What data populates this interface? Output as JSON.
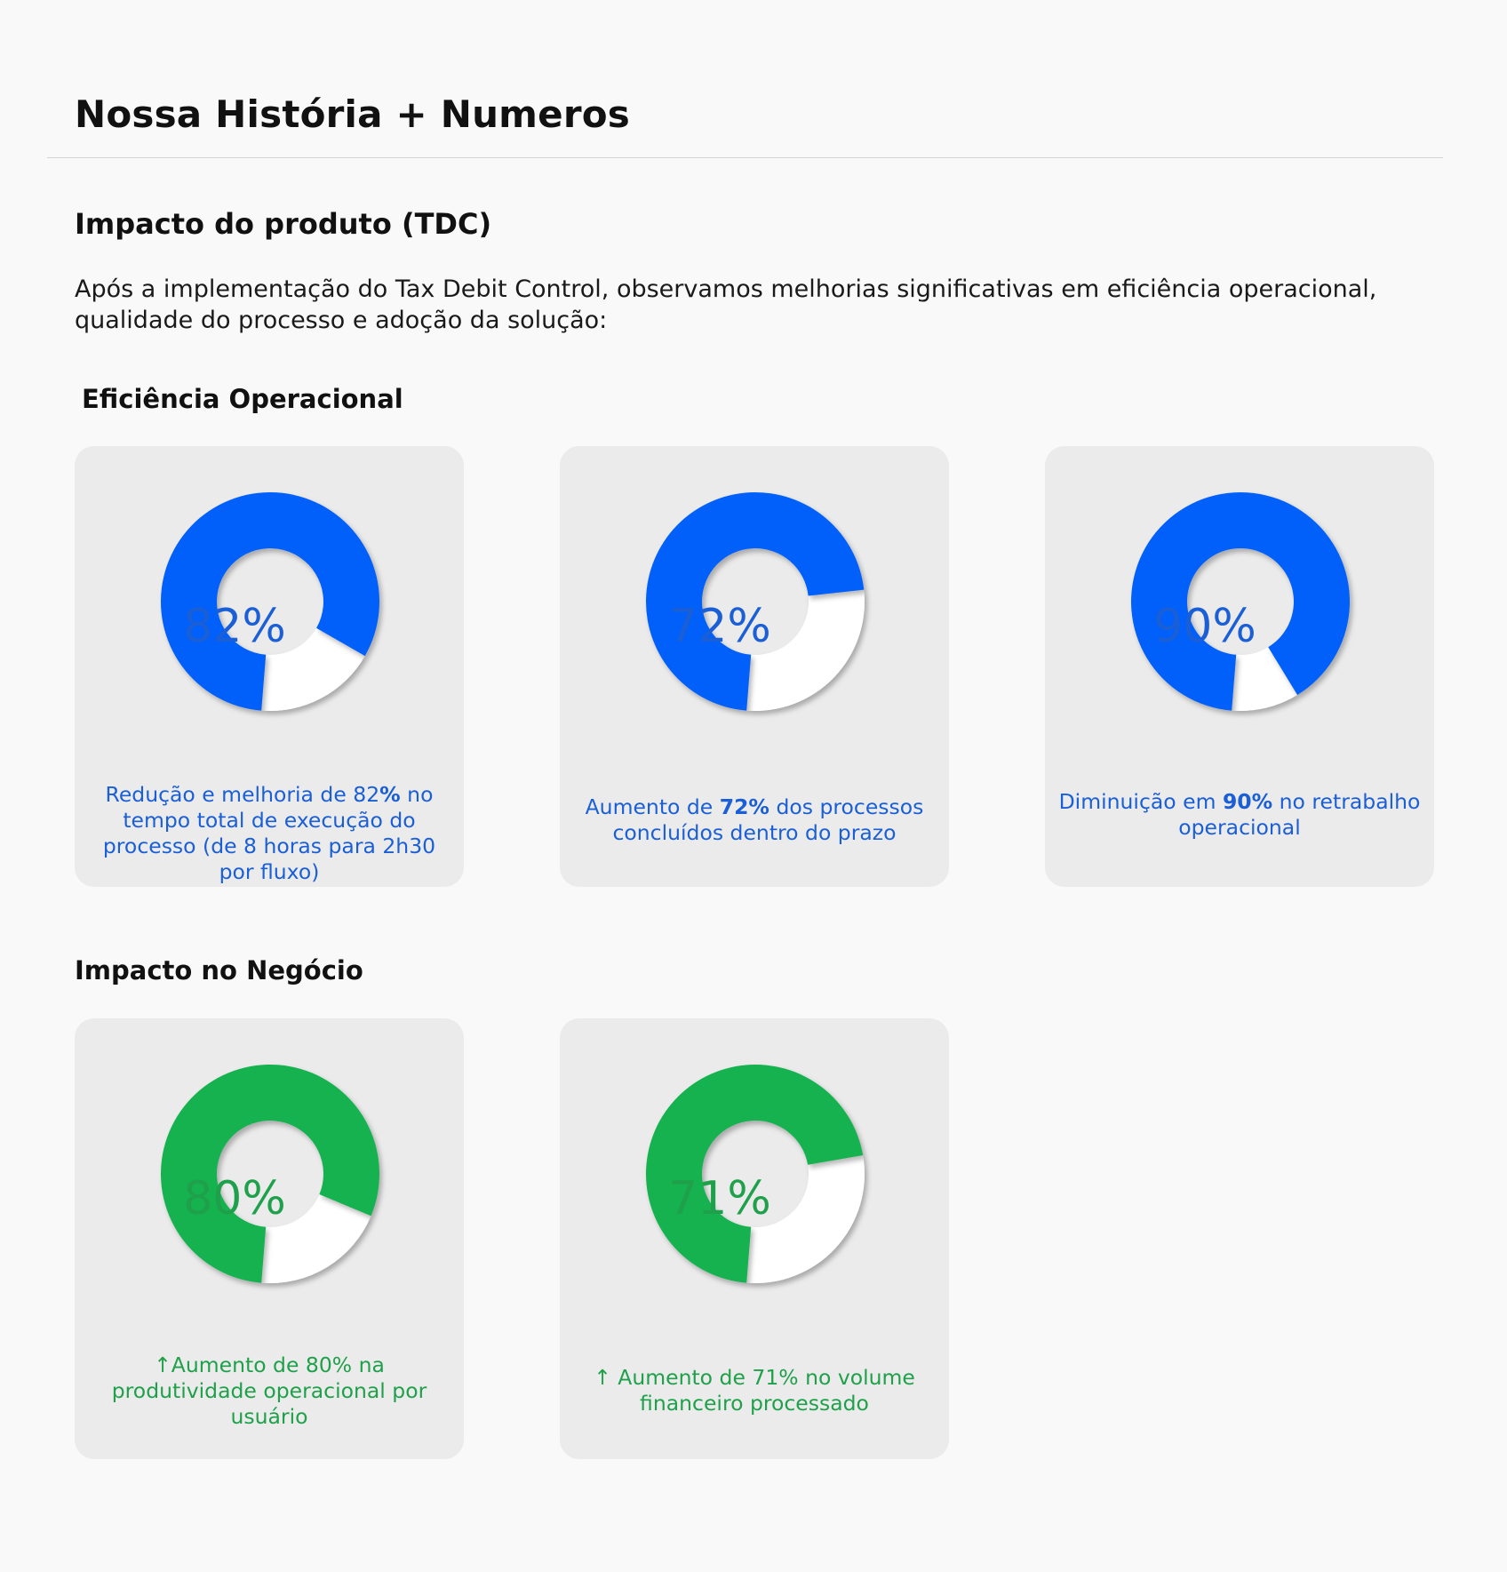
{
  "page": {
    "title": "Nossa História + Numeros",
    "section_title": "Impacto do produto (TDC)",
    "intro": "Após a implementação do Tax Debit Control, observamos melhorias significativas em eficiência operacional, qualidade do processo e adoção da solução:"
  },
  "colors": {
    "blue": "#0060f9",
    "blue_text": "#1a5fd6",
    "green": "#17b250",
    "green_text": "#1fa04a",
    "remainder": "#ffffff",
    "card_bg": "#ebebeb"
  },
  "groups": [
    {
      "title": "Eficiência Operacional",
      "cards": [
        {
          "label": "82%",
          "caption_parts": [
            [
              "Redução e melhoria de 82",
              false
            ],
            [
              "%",
              true
            ],
            [
              " no tempo total de execução do processo (de 8 horas para 2h30 por fluxo)",
              false
            ]
          ]
        },
        {
          "label": "72%",
          "caption_parts": [
            [
              "Aumento de ",
              false
            ],
            [
              "72%",
              true
            ],
            [
              " dos processos concluídos dentro do prazo",
              false
            ]
          ]
        },
        {
          "label": "90%",
          "caption_parts": [
            [
              "Diminuição em ",
              false
            ],
            [
              "90%",
              true
            ],
            [
              " no retrabalho operacional",
              false
            ]
          ]
        }
      ]
    },
    {
      "title": "Impacto no Negócio",
      "cards": [
        {
          "label": "80%",
          "caption_parts": [
            [
              "↑Aumento de 80% na produtividade operacional por usuário",
              false
            ]
          ]
        },
        {
          "label": "71%",
          "caption_parts": [
            [
              "↑ Aumento de 71% no volume financeiro processado",
              false
            ]
          ]
        }
      ]
    }
  ],
  "chart_data": [
    {
      "type": "pie",
      "variant": "donut",
      "group": "Eficiência Operacional",
      "values": [
        82,
        18
      ],
      "label": "82%"
    },
    {
      "type": "pie",
      "variant": "donut",
      "group": "Eficiência Operacional",
      "values": [
        72,
        28
      ],
      "label": "72%"
    },
    {
      "type": "pie",
      "variant": "donut",
      "group": "Eficiência Operacional",
      "values": [
        90,
        10
      ],
      "label": "90%"
    },
    {
      "type": "pie",
      "variant": "donut",
      "group": "Impacto no Negócio",
      "values": [
        80,
        20
      ],
      "label": "80%"
    },
    {
      "type": "pie",
      "variant": "donut",
      "group": "Impacto no Negócio",
      "values": [
        71,
        29
      ],
      "label": "71%"
    }
  ]
}
